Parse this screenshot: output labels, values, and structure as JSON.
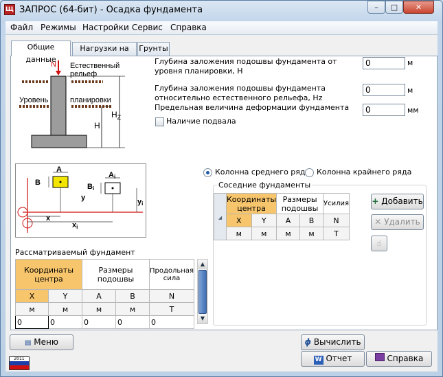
{
  "window": {
    "title": "ЗАПРОС (64-бит) - Осадка фундамента",
    "minimize": "–",
    "maximize": "□",
    "close": "✕"
  },
  "menu": [
    "Файл",
    "Режимы",
    "Настройки",
    "Сервис",
    "Справка"
  ],
  "tabs": [
    "Общие данные",
    "Нагрузки на пол",
    "Грунты"
  ],
  "diagram1": {
    "n": "N",
    "relief": "Естественный\nрельеф",
    "level": "Уровень",
    "planning": "планировки",
    "h": "H",
    "hz": "Hz"
  },
  "diagram2": {
    "a": "A",
    "b": "B",
    "ai": "Ai",
    "bi": "Bi",
    "y": "y",
    "yi": "yi",
    "x": "x",
    "xi": "xi"
  },
  "fields": [
    {
      "label": "Глубина заложения подошвы фундамента от уровня планировки, H",
      "value": "0",
      "unit": "м"
    },
    {
      "label": "Глубина заложения подошвы фундамента относительно естественного рельефа, Hz",
      "value": "0",
      "unit": "м"
    },
    {
      "label": "Предельная величина деформации фундамента",
      "value": "0",
      "unit": "мм"
    }
  ],
  "basement": {
    "label": "Наличие подвала",
    "checked": false
  },
  "column_type": {
    "middle": "Колонна среднего ряда",
    "edge": "Колонна крайнего ряда",
    "selected": "middle"
  },
  "neighbors": {
    "title": "Соседние фундаменты",
    "headers": {
      "coords": "Координаты центра",
      "sizes": "Размеры подошвы",
      "force": "Усилия"
    },
    "cols": [
      "X",
      "Y",
      "A",
      "B",
      "N"
    ],
    "units": [
      "м",
      "м",
      "м",
      "м",
      "Т"
    ],
    "add": "Добавить",
    "remove": "Удалить"
  },
  "foundation": {
    "title": "Рассматриваемый фундамент",
    "headers": {
      "coords": "Координаты центра",
      "sizes": "Размеры подошвы",
      "length": "Продольная сила"
    },
    "cols": [
      "X",
      "Y",
      "A",
      "B",
      "N"
    ],
    "units": [
      "м",
      "м",
      "м",
      "м",
      "Т"
    ],
    "values": [
      "0",
      "0",
      "0",
      "0",
      "0"
    ]
  },
  "footer": {
    "menu": "Меню",
    "calc": "Вычислить",
    "report": "Отчет",
    "help": "Справка",
    "year": "2011"
  },
  "colors": {
    "accent": "#f7c56c",
    "diagram_red": "#d01010",
    "yellow_box": "#f2e600"
  }
}
